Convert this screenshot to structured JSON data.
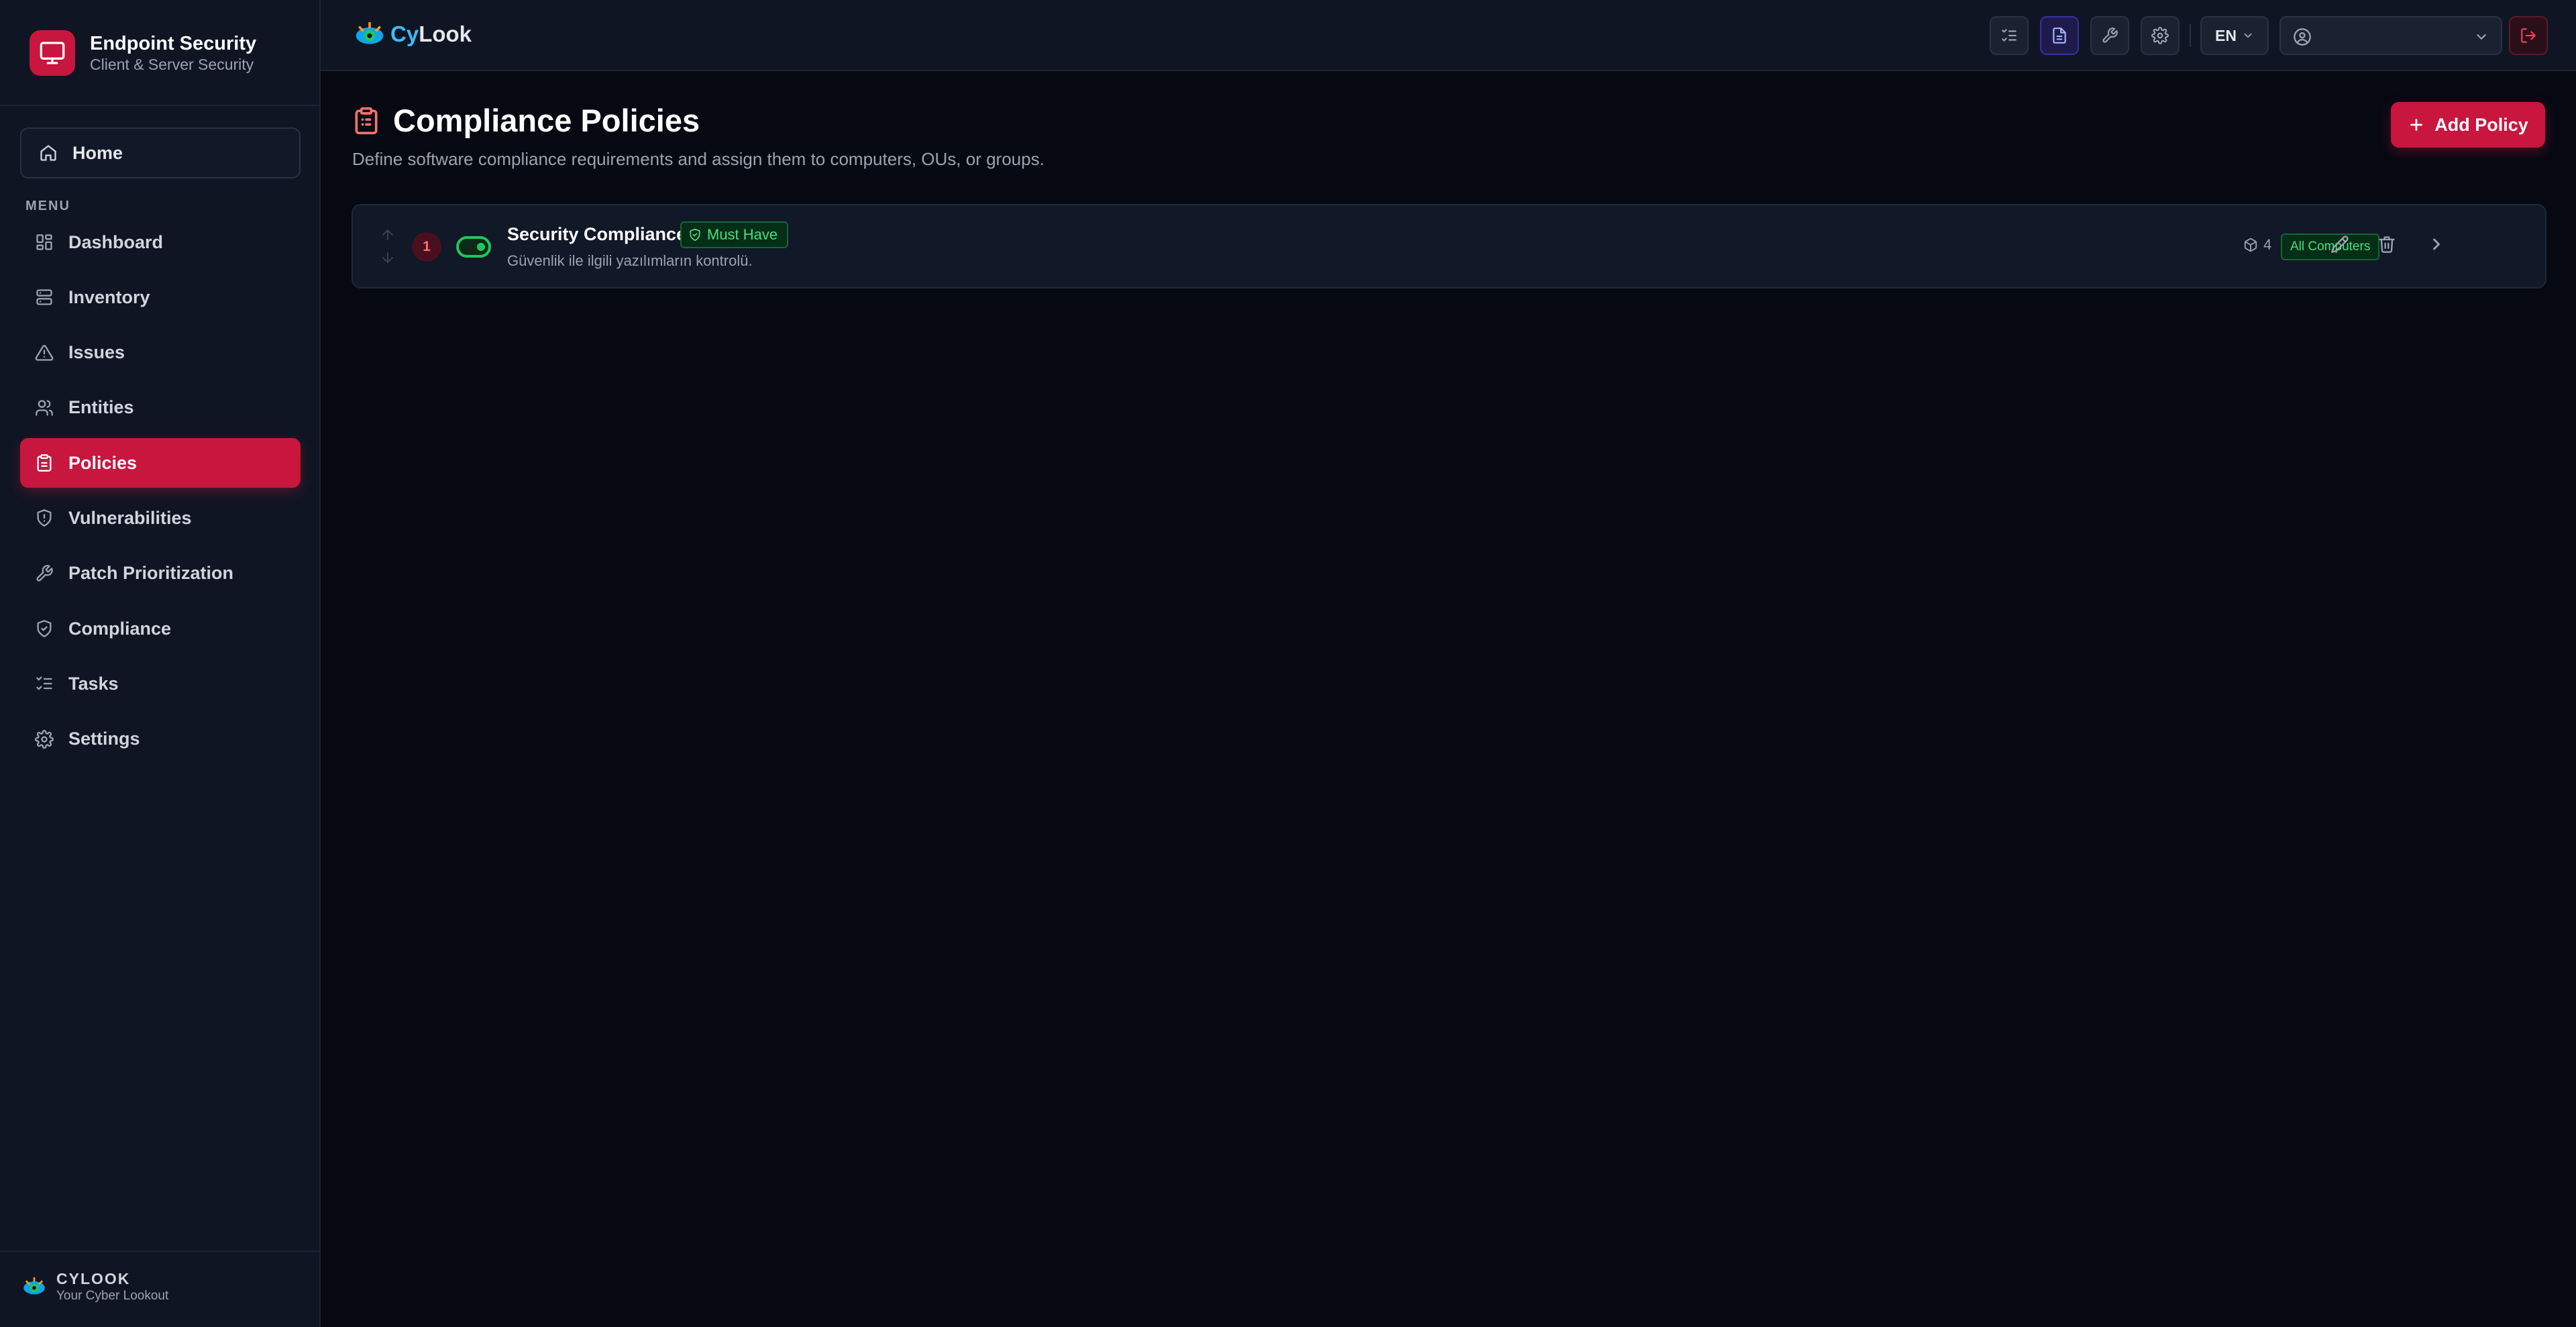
{
  "brand": {
    "title": "Endpoint Security",
    "subtitle": "Client & Server Security",
    "accent": "#c8163e"
  },
  "sidebar": {
    "home_label": "Home",
    "menu_label": "MENU",
    "items": [
      {
        "label": "Dashboard",
        "icon": "dashboard-icon"
      },
      {
        "label": "Inventory",
        "icon": "server-icon"
      },
      {
        "label": "Issues",
        "icon": "warning-icon"
      },
      {
        "label": "Entities",
        "icon": "users-icon"
      },
      {
        "label": "Policies",
        "icon": "clipboard-icon",
        "active": true
      },
      {
        "label": "Vulnerabilities",
        "icon": "shield-icon"
      },
      {
        "label": "Patch Prioritization",
        "icon": "wrench-icon"
      },
      {
        "label": "Compliance",
        "icon": "shield-check-icon"
      },
      {
        "label": "Tasks",
        "icon": "list-checks-icon"
      },
      {
        "label": "Settings",
        "icon": "gear-icon"
      }
    ],
    "footer": {
      "title": "CYLOOK",
      "tagline": "Your Cyber Lookout"
    }
  },
  "header": {
    "logo_cy": "Cy",
    "logo_look": "Look",
    "language": "EN",
    "user": ""
  },
  "page": {
    "title": "Compliance Policies",
    "description": "Define software compliance requirements and assign them to computers, OUs, or groups.",
    "add_button": "Add Policy"
  },
  "policies": [
    {
      "order": "1",
      "enabled": true,
      "name": "Security Compliance",
      "badge": "Must Have",
      "description": "Güvenlik ile ilgili yazılımların kontrolü.",
      "count": "4",
      "target": "All Computers"
    }
  ]
}
